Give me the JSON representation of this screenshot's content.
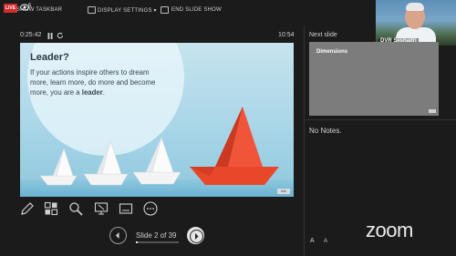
{
  "toolbar": {
    "live_badge": "LIVE",
    "viewer_count": "5",
    "show_taskbar": "SHOW TASKBAR",
    "display_settings": "DISPLAY SETTINGS ▾",
    "end_slide_show": "END SLIDE SHOW"
  },
  "video": {
    "participant_name": "DVR Seshadri"
  },
  "presenter": {
    "elapsed_time": "0:25:42",
    "clock": "10:54"
  },
  "slide": {
    "title": "Leader?",
    "body_pre": "If your actions inspire others to dream more, learn more, do more and become more, you are a ",
    "body_emph": "leader",
    "body_post": ".",
    "credit": "Image credit: photo of paper boats, one red boat leading white boats",
    "logo": "bbb",
    "colors": {
      "lead_boat": "#e8472a",
      "other_boats": "#f4f4f4",
      "sky": "#b8dfee"
    }
  },
  "tools": {
    "pen": "pen-icon",
    "slides": "see-all-slides-icon",
    "zoom": "zoom-in-icon",
    "pointer": "laser-pointer-icon",
    "subtitles": "subtitles-icon",
    "more": "more-options-icon"
  },
  "navigation": {
    "counter": "Slide 2 of 39",
    "progress": 0.05
  },
  "next_slide": {
    "label": "Next slide",
    "title": "Dimensions"
  },
  "notes": {
    "text": "No Notes."
  },
  "text_size": {
    "bigger": "A",
    "smaller": "A"
  },
  "brand": {
    "logo_text": "zoom",
    "accent": "#d42b2b"
  }
}
